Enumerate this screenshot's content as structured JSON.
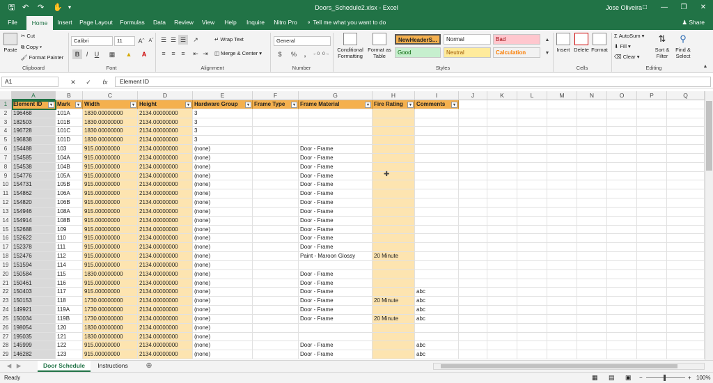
{
  "window": {
    "title": "Doors_Schedule2.xlsx  -  Excel",
    "user": "Jose Oliveira",
    "quick_access": [
      "save-icon",
      "undo-icon",
      "redo-icon",
      "touch-mode-icon",
      "customize-icon"
    ],
    "controls": [
      "ribbon-display-icon",
      "minimize-icon",
      "restore-icon",
      "close-icon"
    ]
  },
  "tabs": [
    "File",
    "Home",
    "Insert",
    "Page Layout",
    "Formulas",
    "Data",
    "Review",
    "View",
    "Help",
    "Inquire",
    "Nitro Pro"
  ],
  "active_tab": "Home",
  "tell_me": "Tell me what you want to do",
  "share": "Share",
  "ribbon": {
    "clipboard": {
      "label": "Clipboard",
      "paste": "Paste",
      "cut": "Cut",
      "copy": "Copy",
      "format_painter": "Format Painter"
    },
    "font": {
      "label": "Font",
      "family": "Calibri",
      "size": "11",
      "bold": "B",
      "italic": "I",
      "underline": "U"
    },
    "alignment": {
      "label": "Alignment",
      "wrap": "Wrap Text",
      "merge": "Merge & Center"
    },
    "number": {
      "label": "Number",
      "format": "General",
      "currency": "$",
      "percent": "%",
      "comma": ","
    },
    "styles": {
      "label": "Styles",
      "conditional": "Conditional\nFormatting",
      "format_table": "Format as\nTable",
      "cells": [
        {
          "name": "NewHeaderS...",
          "bg": "#f4b04e",
          "fg": "#222"
        },
        {
          "name": "Normal",
          "bg": "#ffffff",
          "fg": "#222"
        },
        {
          "name": "Bad",
          "bg": "#ffc7ce",
          "fg": "#9c0006"
        },
        {
          "name": "Good",
          "bg": "#c6efce",
          "fg": "#006100"
        },
        {
          "name": "Neutral",
          "bg": "#ffeb9c",
          "fg": "#9c5700"
        },
        {
          "name": "Calculation",
          "bg": "#f2f2f2",
          "fg": "#fa7d00"
        }
      ]
    },
    "cells": {
      "label": "Cells",
      "insert": "Insert",
      "delete": "Delete",
      "format": "Format"
    },
    "editing": {
      "label": "Editing",
      "autosum": "AutoSum",
      "fill": "Fill",
      "clear": "Clear",
      "sort": "Sort &\nFilter",
      "find": "Find &\nSelect"
    }
  },
  "formula_bar": {
    "name_box": "A1",
    "fx": "fx",
    "value": "Element ID"
  },
  "columns": [
    "A",
    "B",
    "C",
    "D",
    "E",
    "F",
    "G",
    "H",
    "I",
    "J",
    "K",
    "L",
    "M",
    "N",
    "O",
    "P",
    "Q"
  ],
  "header_row": [
    "Element ID",
    "Mark",
    "Width",
    "Height",
    "Hardware Group",
    "Frame Type",
    "Frame Material",
    "Fire Rating",
    "Comments"
  ],
  "rows": [
    [
      "196468",
      "101A",
      "1830.00000000",
      "2134.00000000",
      "3",
      "",
      "",
      "",
      ""
    ],
    [
      "182503",
      "101B",
      "1830.00000000",
      "2134.00000000",
      "3",
      "",
      "",
      "",
      ""
    ],
    [
      "196728",
      "101C",
      "1830.00000000",
      "2134.00000000",
      "3",
      "",
      "",
      "",
      ""
    ],
    [
      "196838",
      "101D",
      "1830.00000000",
      "2134.00000000",
      "3",
      "",
      "",
      "",
      ""
    ],
    [
      "154488",
      "103",
      "915.00000000",
      "2134.00000000",
      "(none)",
      "",
      "Door - Frame",
      "",
      ""
    ],
    [
      "154585",
      "104A",
      "915.00000000",
      "2134.00000000",
      "(none)",
      "",
      "Door - Frame",
      "",
      ""
    ],
    [
      "154538",
      "104B",
      "915.00000000",
      "2134.00000000",
      "(none)",
      "",
      "Door - Frame",
      "",
      ""
    ],
    [
      "154776",
      "105A",
      "915.00000000",
      "2134.00000000",
      "(none)",
      "",
      "Door - Frame",
      "",
      ""
    ],
    [
      "154731",
      "105B",
      "915.00000000",
      "2134.00000000",
      "(none)",
      "",
      "Door - Frame",
      "",
      ""
    ],
    [
      "154862",
      "106A",
      "915.00000000",
      "2134.00000000",
      "(none)",
      "",
      "Door - Frame",
      "",
      ""
    ],
    [
      "154820",
      "106B",
      "915.00000000",
      "2134.00000000",
      "(none)",
      "",
      "Door - Frame",
      "",
      ""
    ],
    [
      "154946",
      "108A",
      "915.00000000",
      "2134.00000000",
      "(none)",
      "",
      "Door - Frame",
      "",
      ""
    ],
    [
      "154914",
      "108B",
      "915.00000000",
      "2134.00000000",
      "(none)",
      "",
      "Door - Frame",
      "",
      ""
    ],
    [
      "152688",
      "109",
      "915.00000000",
      "2134.00000000",
      "(none)",
      "",
      "Door - Frame",
      "",
      ""
    ],
    [
      "152622",
      "110",
      "915.00000000",
      "2134.00000000",
      "(none)",
      "",
      "Door - Frame",
      "",
      ""
    ],
    [
      "152378",
      "111",
      "915.00000000",
      "2134.00000000",
      "(none)",
      "",
      "Door - Frame",
      "",
      ""
    ],
    [
      "152476",
      "112",
      "915.00000000",
      "2134.00000000",
      "(none)",
      "",
      "Paint - Maroon Glossy",
      "20 Minute",
      ""
    ],
    [
      "151594",
      "114",
      "915.00000000",
      "2134.00000000",
      "(none)",
      "",
      "",
      "",
      ""
    ],
    [
      "150584",
      "115",
      "1830.00000000",
      "2134.00000000",
      "(none)",
      "",
      "Door - Frame",
      "",
      ""
    ],
    [
      "150461",
      "116",
      "915.00000000",
      "2134.00000000",
      "(none)",
      "",
      "Door - Frame",
      "",
      ""
    ],
    [
      "150403",
      "117",
      "915.00000000",
      "2134.00000000",
      "(none)",
      "",
      "Door - Frame",
      "",
      "abc"
    ],
    [
      "150153",
      "118",
      "1730.00000000",
      "2134.00000000",
      "(none)",
      "",
      "Door - Frame",
      "20 Minute",
      "abc"
    ],
    [
      "149921",
      "119A",
      "1730.00000000",
      "2134.00000000",
      "(none)",
      "",
      "Door - Frame",
      "",
      "abc"
    ],
    [
      "150034",
      "119B",
      "1730.00000000",
      "2134.00000000",
      "(none)",
      "",
      "Door - Frame",
      "20 Minute",
      "abc"
    ],
    [
      "198054",
      "120",
      "1830.00000000",
      "2134.00000000",
      "(none)",
      "",
      "",
      "",
      ""
    ],
    [
      "195035",
      "121",
      "1830.00000000",
      "2134.00000000",
      "(none)",
      "",
      "",
      "",
      ""
    ],
    [
      "145999",
      "122",
      "915.00000000",
      "2134.00000000",
      "(none)",
      "",
      "Door - Frame",
      "",
      "abc"
    ],
    [
      "146282",
      "123",
      "915.00000000",
      "2134.00000000",
      "(none)",
      "",
      "Door - Frame",
      "",
      "abc"
    ]
  ],
  "sheet_tabs": [
    "Door Schedule",
    "Instructions"
  ],
  "active_sheet": "Door Schedule",
  "status": {
    "ready": "Ready",
    "zoom": "100%"
  }
}
